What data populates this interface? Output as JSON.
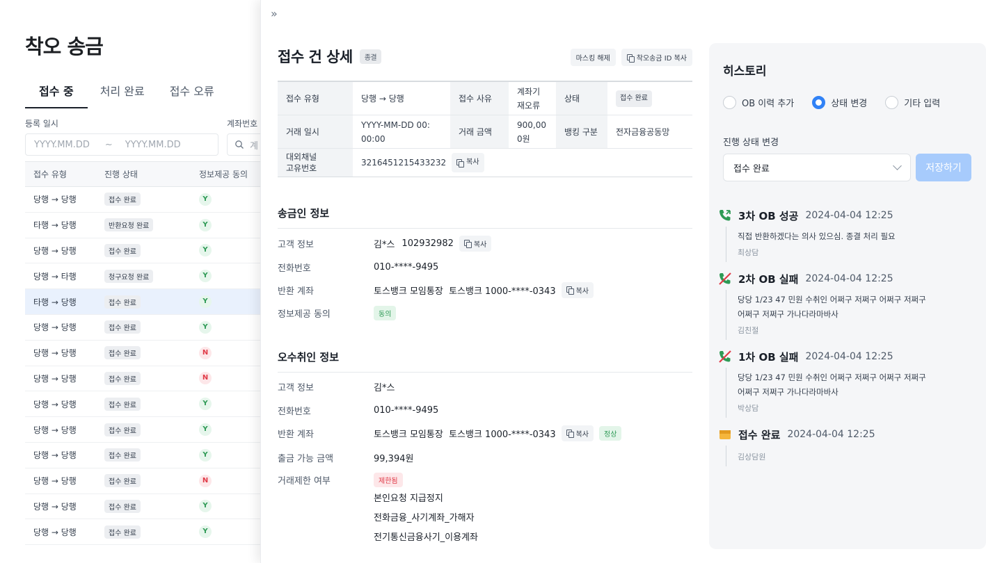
{
  "background": {
    "title": "착오 송금",
    "tabs": [
      "접수 중",
      "처리 완료",
      "접수 오류"
    ],
    "filters": {
      "date_label": "등록 일시",
      "date_from": "YYYY.MM.DD",
      "date_sep": "~",
      "date_to": "YYYY.MM.DD",
      "account_label": "계좌번호",
      "account_placeholder": "계"
    },
    "table": {
      "headers": [
        "접수 유형",
        "진행 상태",
        "정보제공 동의"
      ],
      "rows": [
        {
          "type": "당행 → 당행",
          "status": "접수 완료",
          "consent": "Y"
        },
        {
          "type": "타행 → 당행",
          "status": "반환요청 완료",
          "consent": "Y"
        },
        {
          "type": "당행 → 당행",
          "status": "접수 완료",
          "consent": "Y"
        },
        {
          "type": "당행 → 타행",
          "status": "청구요청 완료",
          "consent": "Y"
        },
        {
          "type": "타행 → 당행",
          "status": "접수 완료",
          "consent": "Y"
        },
        {
          "type": "당행 → 당행",
          "status": "접수 완료",
          "consent": "Y"
        },
        {
          "type": "당행 → 당행",
          "status": "접수 완료",
          "consent": "N"
        },
        {
          "type": "당행 → 당행",
          "status": "접수 완료",
          "consent": "N"
        },
        {
          "type": "당행 → 당행",
          "status": "접수 완료",
          "consent": "Y"
        },
        {
          "type": "당행 → 당행",
          "status": "접수 완료",
          "consent": "Y"
        },
        {
          "type": "당행 → 당행",
          "status": "접수 완료",
          "consent": "Y"
        },
        {
          "type": "당행 → 당행",
          "status": "접수 완료",
          "consent": "N"
        },
        {
          "type": "당행 → 당행",
          "status": "접수 완료",
          "consent": "Y"
        },
        {
          "type": "당행 → 당행",
          "status": "접수 완료",
          "consent": "Y"
        }
      ]
    }
  },
  "detail": {
    "collapse_icon": "»",
    "title": "접수 건 상세",
    "status_chip": "종결",
    "unmask_btn": "마스킹 해제",
    "copy_id_btn": "착오송금 ID 복사",
    "info": {
      "type_k": "접수 유형",
      "type_v": "당행 → 당행",
      "reason_k": "접수 사유",
      "reason_v1": "계좌기",
      "reason_v2": "재오류",
      "state_k": "상태",
      "state_v": "접수 완료",
      "date_k": "거래 일시",
      "date_v1": "YYYY-MM-DD 00:",
      "date_v2": "00:00",
      "amount_k": "거래 금액",
      "amount_v1": "900,00",
      "amount_v2": "0원",
      "bank_k": "뱅킹 구분",
      "bank_v": "전자금융공동망",
      "channel_k1": "대외채널",
      "channel_k2": "고유번호",
      "channel_v": "3216451215433232",
      "copy": "복사"
    },
    "sender": {
      "title": "송금인 정보",
      "customer_k": "고객 정보",
      "customer_name": "김*스",
      "customer_id": "102932982",
      "phone_k": "전화번호",
      "phone_v": "010-****-9495",
      "account_k": "반환 계좌",
      "account_v": "토스뱅크 모임통장  토스뱅크 1000-****-0343",
      "consent_k": "정보제공 동의",
      "consent_v": "동의",
      "copy": "복사"
    },
    "receiver": {
      "title": "오수취인 정보",
      "customer_k": "고객 정보",
      "customer_name": "김*스",
      "phone_k": "전화번호",
      "phone_v": "010-****-9495",
      "account_k": "반환 계좌",
      "account_v": "토스뱅크 모임통장  토스뱅크 1000-****-0343",
      "account_status": "정상",
      "balance_k": "출금 가능 금액",
      "balance_v": "99,394원",
      "restrict_k": "거래제한 여부",
      "restrict_tag": "제한됨",
      "restrict_lines": [
        "본인요청 지급정지",
        "전화금융_사기계좌_가해자",
        "전기통신금융사기_이용계좌"
      ],
      "copy": "복사"
    }
  },
  "history": {
    "title": "히스토리",
    "radios": [
      {
        "label": "OB 이력 추가",
        "checked": false
      },
      {
        "label": "상태 변경",
        "checked": true
      },
      {
        "label": "기타 입력",
        "checked": false
      }
    ],
    "sub_label": "진행 상태 변경",
    "select_value": "접수 완료",
    "save_label": "저장하기",
    "items": [
      {
        "icon": "phone-success-icon",
        "title": "3차 OB 성공",
        "time": "2024-04-04 12:25",
        "desc": [
          "직접 반환하겠다는 의사 있으심. 종결 처리 필요"
        ],
        "agent": "최상담"
      },
      {
        "icon": "phone-fail-icon",
        "title": "2차 OB 실패",
        "time": "2024-04-04 12:25",
        "desc": [
          "당당 1/23 47 민원 수취인 어쩌구 저쩌구 어쩌구 저쩌구",
          "어쩌구 저쩌구 가나다라마바사"
        ],
        "agent": "김친절"
      },
      {
        "icon": "phone-fail-icon",
        "title": "1차 OB 실패",
        "time": "2024-04-04 12:25",
        "desc": [
          "당당 1/23 47 민원 수취인 어쩌구 저쩌구 어쩌구 저쩌구",
          "어쩌구 저쩌구 가나다라마바사"
        ],
        "agent": "박상담"
      },
      {
        "icon": "box-icon",
        "title": "접수 완료",
        "time": "2024-04-04 12:25",
        "desc": [],
        "agent": "김상담원"
      }
    ],
    "colors": {
      "accent": "#3182f6",
      "success": "#2e9a55",
      "fail": "#e03b48",
      "box": "#f5b63c"
    }
  }
}
